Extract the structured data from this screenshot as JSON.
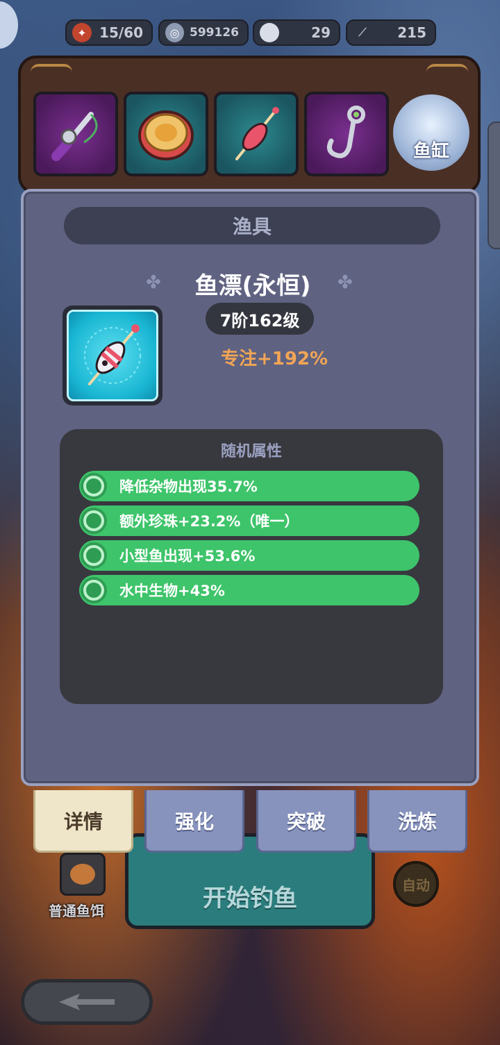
{
  "resources": [
    {
      "icon": "bait-tackle-icon",
      "value": "15/60"
    },
    {
      "icon": "coin-icon",
      "value": "599126"
    },
    {
      "icon": "pearl-icon",
      "value": "29"
    },
    {
      "icon": "fishing-line-icon",
      "value": "215"
    }
  ],
  "equipment": {
    "tank_label": "鱼缸"
  },
  "modal": {
    "header": "渔具",
    "item_name": "鱼漂(永恒)",
    "level": "7阶162级",
    "main_stat": "专注+192%",
    "attributes_title": "随机属性",
    "attributes": [
      "降低杂物出现35.7%",
      "额外珍珠+23.2%（唯一）",
      "小型鱼出现+53.6%",
      "水中生物+43%"
    ]
  },
  "tabs": [
    "详情",
    "强化",
    "突破",
    "洗炼"
  ],
  "bottom": {
    "start_label": "开始钓鱼",
    "bait_label": "普通鱼饵",
    "bait_count": "∞",
    "auto_label": "自动"
  },
  "colors": {
    "attribute_row": "#3ec46a",
    "main_stat": "#f2a556",
    "modal_bg": "#5f6280",
    "tab_active": "#efe6c9",
    "tab_inactive": "#8793bd"
  }
}
